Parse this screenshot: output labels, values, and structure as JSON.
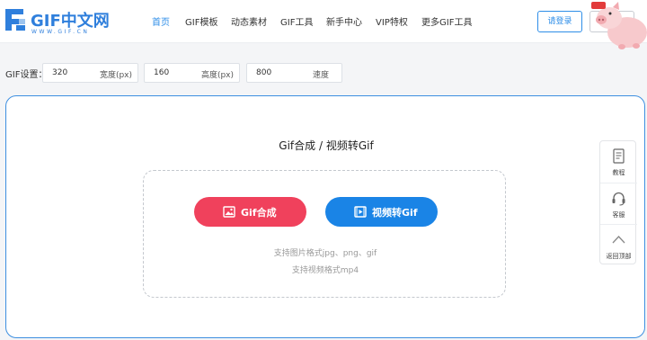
{
  "brand": {
    "logo_text": "GIF中文网",
    "logo_sub": "WWW.GIF.CN"
  },
  "nav": {
    "items": [
      {
        "label": "首页",
        "active": true
      },
      {
        "label": "GIF模板",
        "active": false
      },
      {
        "label": "动态素材",
        "active": false
      },
      {
        "label": "GIF工具",
        "active": false
      },
      {
        "label": "新手中心",
        "active": false
      },
      {
        "label": "VIP特权",
        "active": false
      },
      {
        "label": "更多GIF工具",
        "active": false
      }
    ]
  },
  "header": {
    "login_label": "请登录"
  },
  "settings": {
    "label": "GIF设置：",
    "width": {
      "value": "320",
      "unit": "宽度(px)"
    },
    "height": {
      "value": "160",
      "unit": "高度(px)"
    },
    "speed": {
      "value": "800",
      "unit": "速度"
    }
  },
  "main": {
    "title": "Gif合成 / 视频转Gif",
    "gif_button_label": "Gif合成",
    "video_button_label": "视频转Gif",
    "hint_images": "支持图片格式jpg、png、gif",
    "hint_video": "支持视频格式mp4"
  },
  "side_tools": {
    "tutorial": "教程",
    "service": "客服",
    "top": "返回顶部"
  },
  "colors": {
    "accent": "#2e8ee8",
    "gif_button": "#f0415c",
    "video_button": "#1a84e6"
  },
  "icons": {
    "gif_button": "image-icon",
    "video_button": "video-icon",
    "tutorial": "document-icon",
    "service": "headset-icon",
    "top": "chevron-up-icon"
  }
}
